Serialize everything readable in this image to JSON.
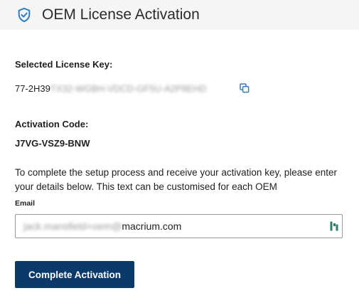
{
  "header": {
    "title": "OEM License Activation",
    "icon": "shield-check-icon",
    "accent_color": "#2f7fc8"
  },
  "license": {
    "label": "Selected License Key:",
    "key_visible": "77-2H39",
    "key_obscured": "TX32-WGBH-VDCD-GF5U-A2P8EHD",
    "copy_icon": "copy-icon"
  },
  "activation": {
    "label": "Activation Code:",
    "code": "J7VG-VSZ9-BNW"
  },
  "description": "To complete the setup process and receive your activation key, please enter your details below. This text can be customised for each OEM",
  "email": {
    "label": "Email",
    "value_obscured": "jack.mansfield+oem@",
    "value_visible": "macrium.com",
    "trailing_icon": "password-manager-icon"
  },
  "submit": {
    "label": "Complete Activation",
    "color": "#0b3a6a"
  }
}
